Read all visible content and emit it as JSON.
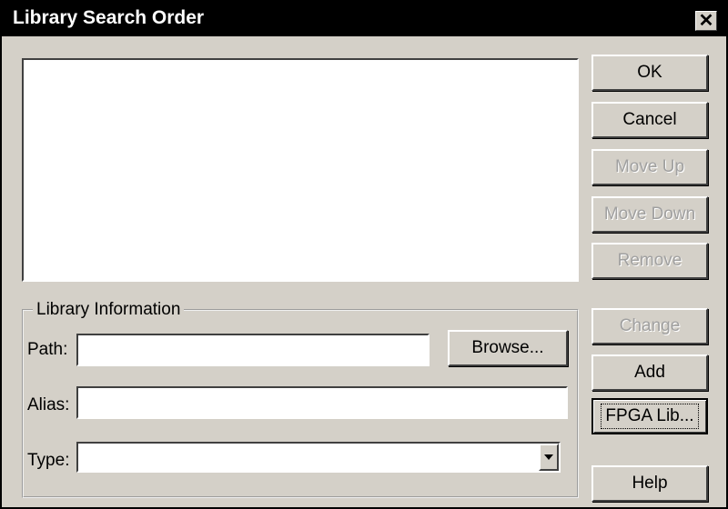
{
  "window": {
    "title": "Library Search Order",
    "close_glyph": "✕"
  },
  "buttons": {
    "ok": "OK",
    "cancel": "Cancel",
    "move_up": "Move Up",
    "move_down": "Move Down",
    "remove": "Remove",
    "change": "Change",
    "add": "Add",
    "fpga_lib": "FPGA Lib...",
    "help": "Help",
    "browse": "Browse..."
  },
  "library_info": {
    "group_label": "Library Information",
    "path_label": "Path:",
    "path_value": "",
    "alias_label": "Alias:",
    "alias_value": "",
    "type_label": "Type:",
    "type_value": ""
  },
  "library_list": {
    "items": []
  },
  "icons": {
    "close": "close-icon",
    "dropdown": "chevron-down-icon"
  }
}
